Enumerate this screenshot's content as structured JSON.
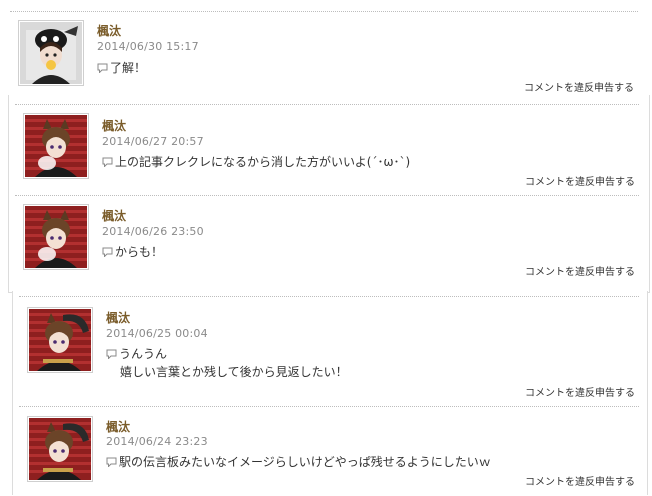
{
  "comments": [
    {
      "author": "楓汰",
      "date": "2014/06/30 15:17",
      "lines": [
        "了解！"
      ],
      "report_label": "コメントを違反申告する",
      "avatar": "avatar-black-bg"
    },
    {
      "author": "楓汰",
      "date": "2014/06/27 20:57",
      "lines": [
        "上の記事クレクレになるから消した方がいいよ(´･ω･`)"
      ],
      "report_label": "コメントを違反申告する",
      "avatar": "avatar-red-stripes"
    },
    {
      "author": "楓汰",
      "date": "2014/06/26 23:50",
      "lines": [
        "からも！"
      ],
      "report_label": "コメントを違反申告する",
      "avatar": "avatar-red-stripes"
    },
    {
      "author": "楓汰",
      "date": "2014/06/25 00:04",
      "lines": [
        "うんうん",
        "嬉しい言葉とか残して後から見返したい！"
      ],
      "report_label": "コメントを違反申告する",
      "avatar": "avatar-red-stripes"
    },
    {
      "author": "楓汰",
      "date": "2014/06/24 23:23",
      "lines": [
        "駅の伝言板みたいなイメージらしいけどやっぱ残せるようにしたいｗ"
      ],
      "report_label": "コメントを違反申告する",
      "avatar": "avatar-red-stripes"
    }
  ],
  "colors": {
    "author": "#7a5c2a",
    "date": "#8a8a8a",
    "border": "#dcdcdc"
  },
  "icons": {
    "comment": "speech-bubble-icon"
  }
}
